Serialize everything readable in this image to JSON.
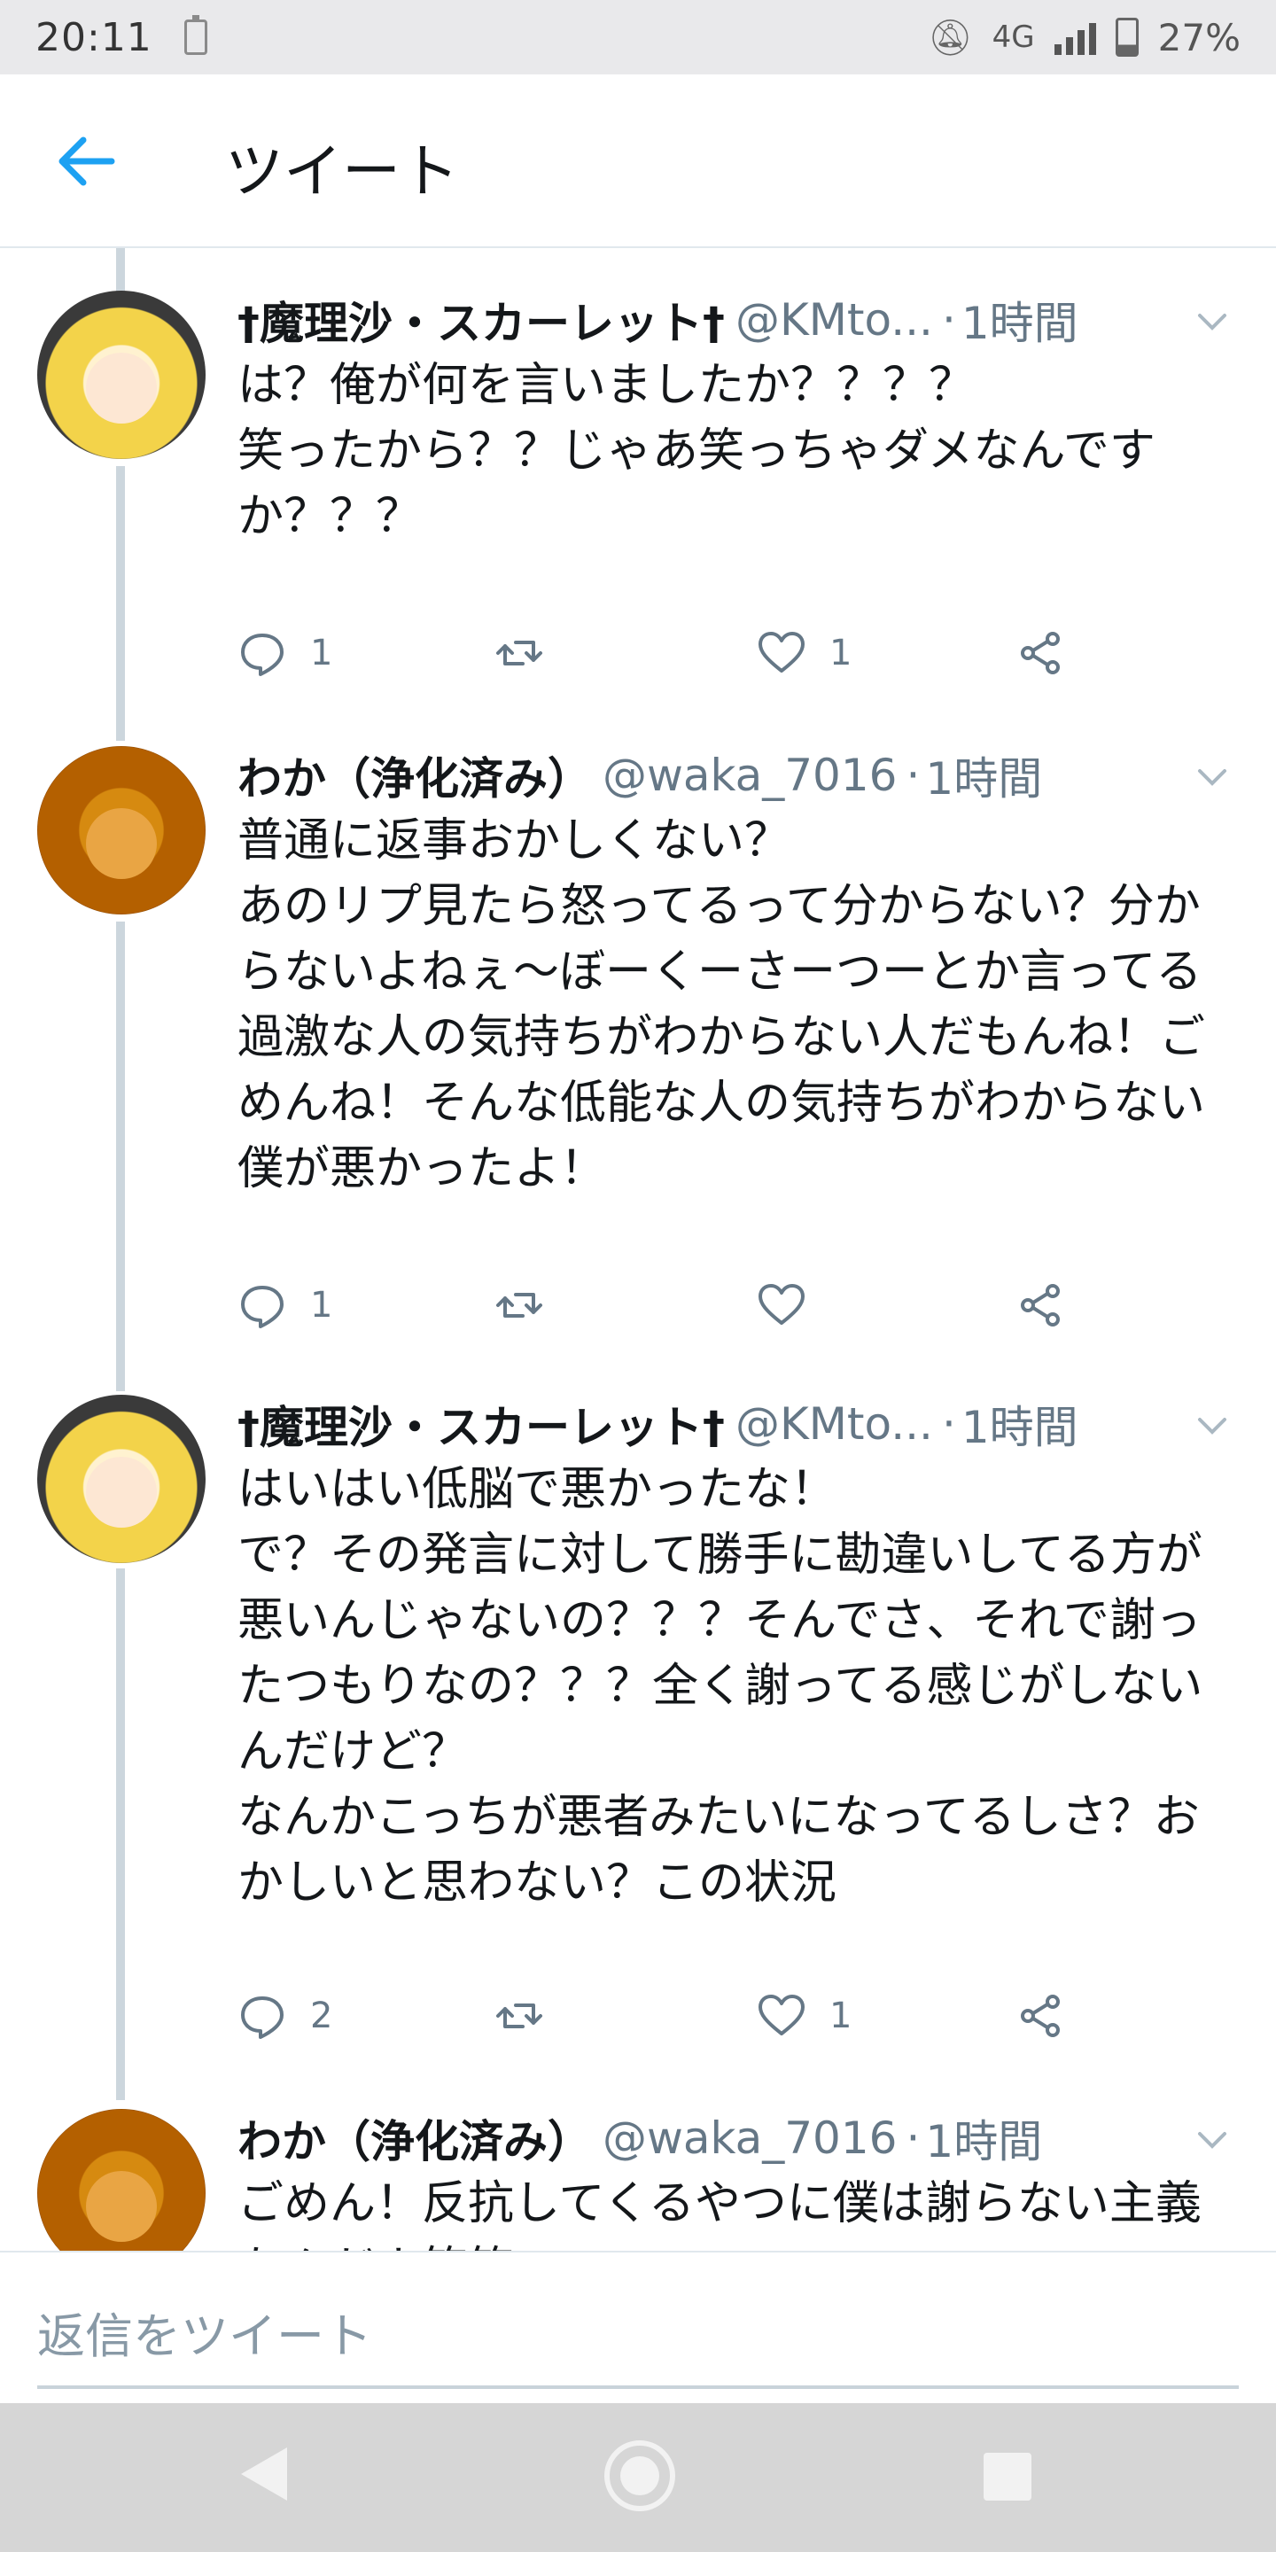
{
  "status_bar": {
    "time": "20:11",
    "network": "4G",
    "battery": "27%",
    "icons": [
      "charging-battery-icon",
      "do-not-disturb-icon",
      "signal-icon",
      "battery-icon"
    ]
  },
  "header": {
    "title": "ツイート",
    "back_icon": "arrow-left-icon"
  },
  "tweets": [
    {
      "name": "†魔理沙・スカーレット†",
      "handle": "@KMto...",
      "sep": "·",
      "time": "1時間",
      "text": "は？俺が何を言いましたか？？？？\n笑ったから？？じゃあ笑っちゃダメなんですか？？？",
      "replies": "1",
      "retweets": "",
      "likes": "1"
    },
    {
      "name": "わか（浄化済み）",
      "handle": "@waka_7016",
      "sep": "·",
      "time": "1時間",
      "text": "普通に返事おかしくない？\nあのリプ見たら怒ってるって分からない？分からないよねぇ〜ぼーくーさーつーとか言ってる過激な人の気持ちがわからない人だもんね！ごめんね！そんな低能な人の気持ちがわからない僕が悪かったよ！",
      "replies": "1",
      "retweets": "",
      "likes": ""
    },
    {
      "name": "†魔理沙・スカーレット†",
      "handle": "@KMto...",
      "sep": "·",
      "time": "1時間",
      "text": "はいはい低脳で悪かったな！\nで？その発言に対して勝手に勘違いしてる方が悪いんじゃないの？？？そんでさ、それで謝ったつもりなの？？？全く謝ってる感じがしないんだけど？\nなんかこっちが悪者みたいになってるしさ？おかしいと思わない？この状況",
      "replies": "2",
      "retweets": "",
      "likes": "1"
    },
    {
      "name": "わか（浄化済み）",
      "handle": "@waka_7016",
      "sep": "·",
      "time": "1時間",
      "text": "ごめん！反抗してくるやつに僕は謝らない主義なんだよ笑笑"
    }
  ],
  "reply_bar": {
    "placeholder": "返信をツイート"
  },
  "nav_bar": {
    "icons": [
      "nav-back-icon",
      "nav-home-icon",
      "nav-recents-icon"
    ]
  },
  "colors": {
    "accent": "#1da1f2",
    "secondary_text": "#657786",
    "thread_line": "#ccd6dd"
  }
}
